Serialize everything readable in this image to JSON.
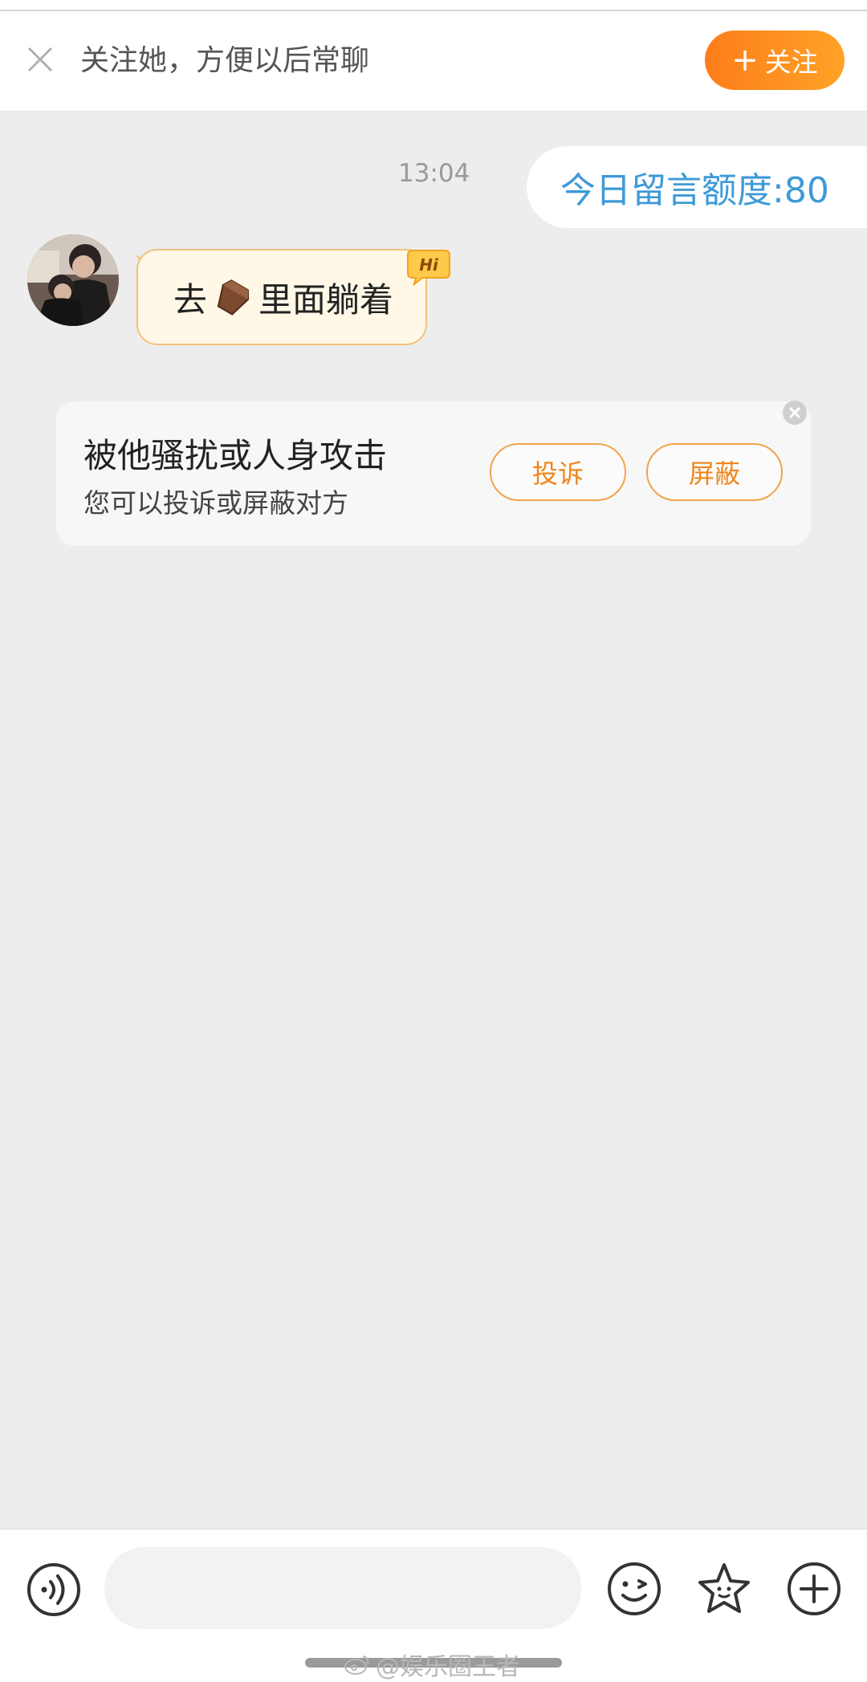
{
  "header": {
    "title": "关注她，方便以后常聊",
    "follow_plus": "+",
    "follow_label": "关注"
  },
  "chat": {
    "timestamp": "13:04",
    "quota_text": "今日留言额度:80",
    "message": {
      "before": "去",
      "after": "里面躺着",
      "emoji": "coffin-emoji"
    },
    "hi_badge": "Hi"
  },
  "report_card": {
    "title": "被他骚扰或人身攻击",
    "subtitle": "您可以投诉或屏蔽对方",
    "report_button": "投诉",
    "block_button": "屏蔽"
  },
  "input_bar": {
    "placeholder": "",
    "icons": [
      "voice-icon",
      "emoji-icon",
      "star-icon",
      "plus-icon"
    ]
  },
  "watermark": "@娱乐圈王者",
  "colors": {
    "accent_orange": "#fd7d1a",
    "quota_blue": "#3e9ad7",
    "bubble_bg": "#fff8e7"
  }
}
